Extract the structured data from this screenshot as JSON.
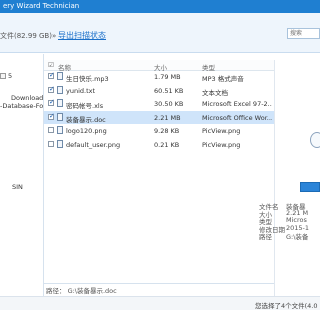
{
  "window": {
    "title": "ery Wizard Technician"
  },
  "toolbar": {
    "file_info": "文件(82.99 GB)»",
    "export_label": "导出扫描状态",
    "search_placeholder": "搜索"
  },
  "sidebar": {
    "items": [
      {
        "label": "5"
      },
      {
        "label": "Download"
      },
      {
        "label": "-Database-For-"
      },
      {
        "label": "SIN"
      }
    ]
  },
  "file_list": {
    "columns": [
      "名称",
      "大小",
      "类型"
    ],
    "rows": [
      {
        "name": "生日快乐.mp3",
        "size": "1.79 MB",
        "type": "MP3 格式声音",
        "checked": true,
        "selected": false
      },
      {
        "name": "yunid.txt",
        "size": "60.51 KB",
        "type": "文本文档",
        "checked": true,
        "selected": false
      },
      {
        "name": "密码帐号.xls",
        "size": "30.50 KB",
        "type": "Microsoft Excel 97-2...",
        "checked": true,
        "selected": false
      },
      {
        "name": "装备暴示.doc",
        "size": "2.21 MB",
        "type": "Microsoft Office Wor...",
        "checked": true,
        "selected": true
      },
      {
        "name": "logo120.png",
        "size": "9.28 KB",
        "type": "PicView.png",
        "checked": false,
        "selected": false
      },
      {
        "name": "default_user.png",
        "size": "0.21 KB",
        "type": "PicView.png",
        "checked": false,
        "selected": false
      }
    ]
  },
  "details": {
    "labels": [
      "文件名",
      "大小",
      "类型",
      "修改日期",
      "路径"
    ],
    "values": [
      "装备暴",
      "2.21 M",
      "Micros",
      "2015-1",
      "G:\\装备"
    ]
  },
  "path_bar": {
    "path": "路径：  G:\\装备暴示.doc"
  },
  "status": {
    "text": "您选择了4个文件(4.0"
  }
}
